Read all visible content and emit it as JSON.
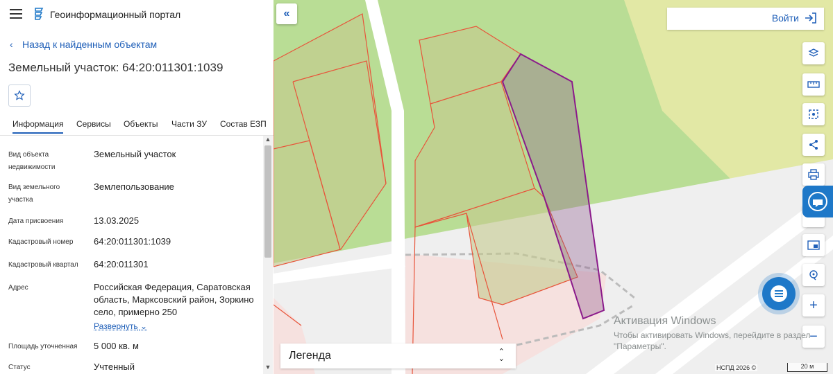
{
  "app": {
    "title": "Геоинформационный портал"
  },
  "nav": {
    "back_label": "Назад к найденным объектам"
  },
  "object": {
    "title": "Земельный участок: 64:20:011301:1039"
  },
  "tabs": [
    {
      "label": "Информация",
      "active": true
    },
    {
      "label": "Сервисы"
    },
    {
      "label": "Объекты"
    },
    {
      "label": "Части ЗУ"
    },
    {
      "label": "Состав ЕЗП"
    }
  ],
  "properties": [
    {
      "label": "Вид объекта недвижимости",
      "value": "Земельный участок"
    },
    {
      "label": "Вид земельного участка",
      "value": "Землепользование"
    },
    {
      "label": "Дата присвоения",
      "value": "13.03.2025"
    },
    {
      "label": "Кадастровый номер",
      "value": "64:20:011301:1039"
    },
    {
      "label": "Кадастровый квартал",
      "value": "64:20:011301"
    },
    {
      "label": "Адрес",
      "value": "Российская Федерация, Саратовская область, Марксовский район, Зоркино село, примерно 250"
    },
    {
      "label": "Площадь уточненная",
      "value": "5 000 кв. м"
    },
    {
      "label": "Статус",
      "value": "Учтенный"
    }
  ],
  "expand_label": "Развернуть",
  "login": {
    "label": "Войти"
  },
  "legend": {
    "label": "Легенда"
  },
  "watermark": {
    "title": "Активация Windows",
    "text": "Чтобы активировать Windows, перейдите в раздел \"Параметры\"."
  },
  "attribution": "НСПД 2026 ©",
  "scale_label": "20 м",
  "colors": {
    "accent": "#1f5fb8",
    "selected_parcel": "#8b1a8b",
    "parcel_border": "#e8543a"
  },
  "toolbar_icons": [
    "layers-icon",
    "ruler-icon",
    "select-area-icon",
    "share-icon",
    "print-icon",
    "help-icon",
    "map-view-icon",
    "location-icon",
    "zoom-in-icon",
    "zoom-out-icon"
  ]
}
